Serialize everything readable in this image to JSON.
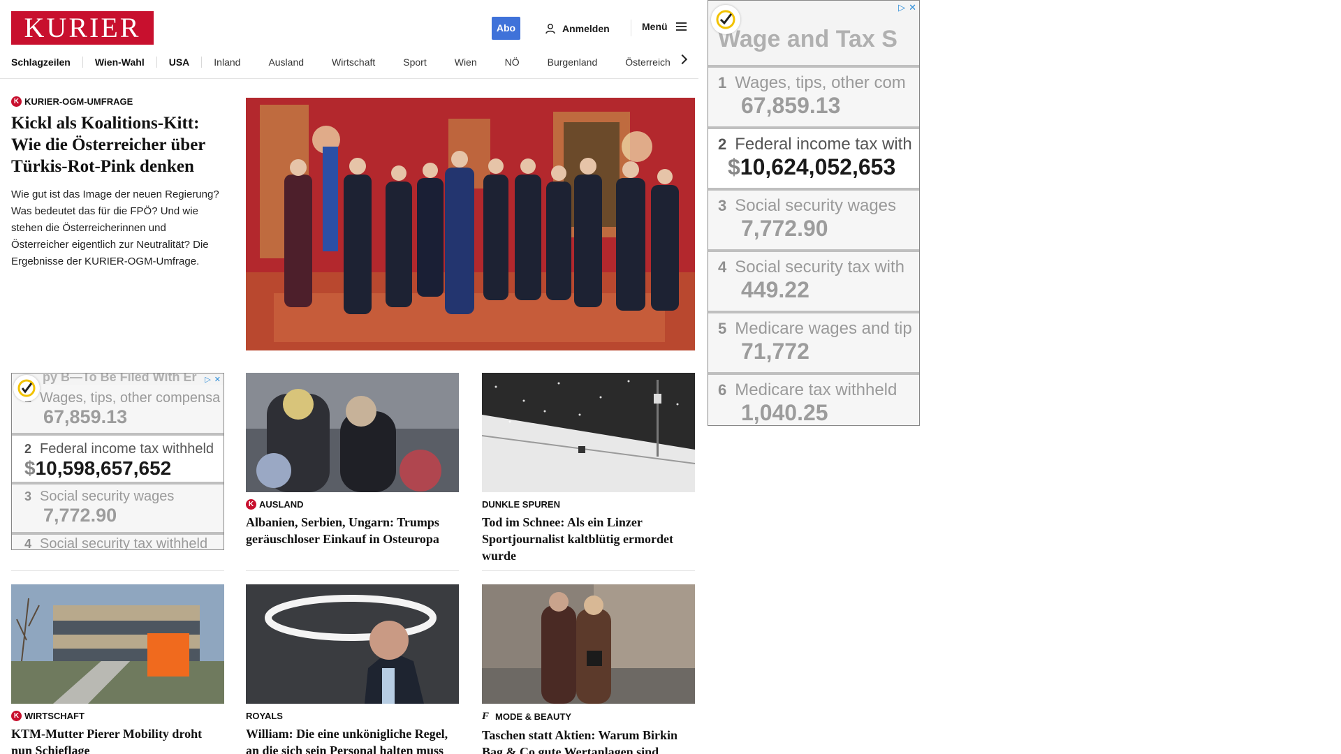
{
  "header": {
    "logo_text": "KURIER",
    "abo_label": "Abo",
    "login_label": "Anmelden",
    "menu_label": "Menü",
    "brand_color": "#c8102e",
    "abo_color": "#3f72d9"
  },
  "nav": {
    "items": [
      "Schlagzeilen",
      "Wien-Wahl",
      "USA",
      "Inland",
      "Ausland",
      "Wirtschaft",
      "Sport",
      "Wien",
      "NÖ",
      "Burgenland",
      "Österreich"
    ]
  },
  "lead": {
    "kicker": "KURIER-OGM-UMFRAGE",
    "title": "Kickl als Koalitions-Kitt: Wie die Österreicher über Türkis-Rot-Pink denken",
    "teaser": "Wie gut ist das Image der neuen Regierung? Was bedeutet das für die FPÖ? Und wie stehen die Österreicherinnen und Österreicher eigentlich zur Neutralität? Die Ergebnisse der KURIER-OGM-Umfrage."
  },
  "cards": [
    {
      "kicker": "AUSLAND",
      "title": "Albanien, Serbien, Ungarn: Trumps geräuschloser Einkauf in Osteuropa",
      "badge": "K"
    },
    {
      "kicker": "DUNKLE SPUREN",
      "title": "Tod im Schnee: Als ein Linzer Sportjournalist kaltblütig ermordet wurde",
      "badge": ""
    },
    {
      "kicker": "WIRTSCHAFT",
      "title": "KTM-Mutter Pierer Mobility droht nun Schieflage",
      "badge": "K"
    },
    {
      "kicker": "ROYALS",
      "title": "William: Die eine unkönigliche Regel, an die sich sein Personal halten muss",
      "badge": ""
    },
    {
      "kicker": "MODE & BEAUTY",
      "title": "Taschen statt Aktien: Warum Birkin Bag & Co gute Wertanlagen sind",
      "badge": "f"
    }
  ],
  "ad_small": {
    "header": "py B—To Be Filed With Er",
    "rows": [
      {
        "num": "1",
        "label": "Wages, tips, other compensa",
        "value": "67,859.13"
      },
      {
        "num": "2",
        "label": "Federal income tax withheld",
        "dollar": "$",
        "value": "10,598,657,652"
      },
      {
        "num": "3",
        "label": "Social security wages",
        "value": "7,772.90"
      },
      {
        "num": "4",
        "label": "Social security tax withheld",
        "value": ""
      }
    ]
  },
  "ad_large": {
    "header": "Wage and Tax S",
    "rows": [
      {
        "num": "1",
        "label": "Wages, tips, other com",
        "value": "67,859.13"
      },
      {
        "num": "2",
        "label": "Federal income tax with",
        "dollar": "$",
        "value": "10,624,052,653"
      },
      {
        "num": "3",
        "label": "Social security wages",
        "value": "7,772.90"
      },
      {
        "num": "4",
        "label": "Social security tax with",
        "value": "449.22"
      },
      {
        "num": "5",
        "label": "Medicare wages and tip",
        "value": "71,772"
      },
      {
        "num": "6",
        "label": "Medicare tax withheld",
        "value": "1,040.25"
      }
    ]
  }
}
